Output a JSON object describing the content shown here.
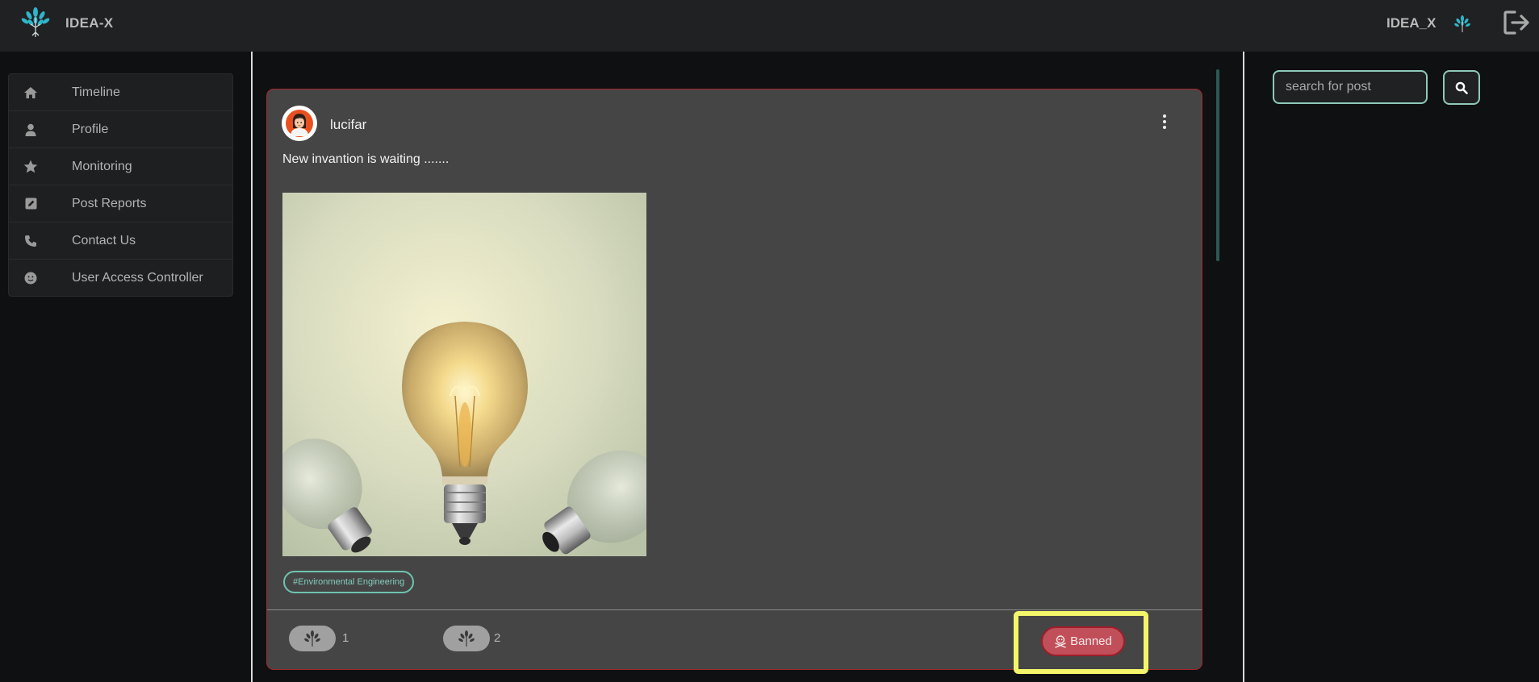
{
  "header": {
    "brand": "IDEA-X",
    "username": "IDEA_X",
    "icons": [
      "tree-logo-icon",
      "small-tree-logo-icon",
      "logout-icon"
    ]
  },
  "sidebar": {
    "items": [
      {
        "label": "Timeline",
        "icon": "home-icon"
      },
      {
        "label": "Profile",
        "icon": "person-icon"
      },
      {
        "label": "Monitoring",
        "icon": "star-icon"
      },
      {
        "label": "Post Reports",
        "icon": "edit-square-icon"
      },
      {
        "label": "Contact Us",
        "icon": "phone-icon"
      },
      {
        "label": "User Access Controller",
        "icon": "face-icon"
      }
    ]
  },
  "post": {
    "author": "lucifar",
    "text": "New invantion is waiting .......",
    "tag": "#Environmental Engineering",
    "reactions": [
      {
        "icon": "tree-react-icon",
        "count": "1"
      },
      {
        "icon": "tree-react-icon",
        "count": "2"
      }
    ],
    "status_button": {
      "label": "Banned",
      "icon": "skull-icon"
    }
  },
  "search": {
    "placeholder": "search for post",
    "button_icon": "search-icon"
  },
  "colors": {
    "background": "#0f1012",
    "topbar": "#202122",
    "card": "#454545",
    "card_border": "#a3262a",
    "accent_teal": "#8fc9ba",
    "banned": "#c14f59",
    "highlight": "#f3f56a"
  }
}
